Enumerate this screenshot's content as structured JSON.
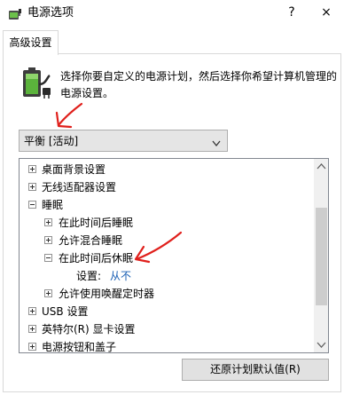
{
  "window": {
    "title": "电源选项",
    "help_glyph": "?",
    "close_glyph": "×"
  },
  "tabs": [
    {
      "label": "高级设置"
    }
  ],
  "description": "选择你要自定义的电源计划，然后选择你希望计算机管理的电源设置。",
  "plan_select": {
    "value": "平衡 [活动]"
  },
  "tree": {
    "items": [
      {
        "label": "桌面背景设置",
        "expander": "plus"
      },
      {
        "label": "无线适配器设置",
        "expander": "plus"
      },
      {
        "label": "睡眠",
        "expander": "minus"
      },
      {
        "label": "在此时间后睡眠",
        "expander": "plus"
      },
      {
        "label": "允许混合睡眠",
        "expander": "plus"
      },
      {
        "label": "在此时间后休眠",
        "expander": "minus"
      },
      {
        "label": "设置:",
        "value": "从不"
      },
      {
        "label": "允许使用唤醒定时器",
        "expander": "plus"
      },
      {
        "label": "USB 设置",
        "expander": "plus"
      },
      {
        "label": "英特尔(R) 显卡设置",
        "expander": "plus"
      },
      {
        "label": "电源按钮和盖子",
        "expander": "plus"
      }
    ]
  },
  "buttons": {
    "restore_defaults": "还原计划默认值(R)"
  },
  "colors": {
    "annotation": "#e0201c",
    "link": "#1a5fb4"
  },
  "icons": {
    "app": "power-options-icon",
    "plan": "battery-plug-icon",
    "help": "help-icon",
    "close": "close-icon",
    "dropdown": "chevron-down-icon"
  }
}
